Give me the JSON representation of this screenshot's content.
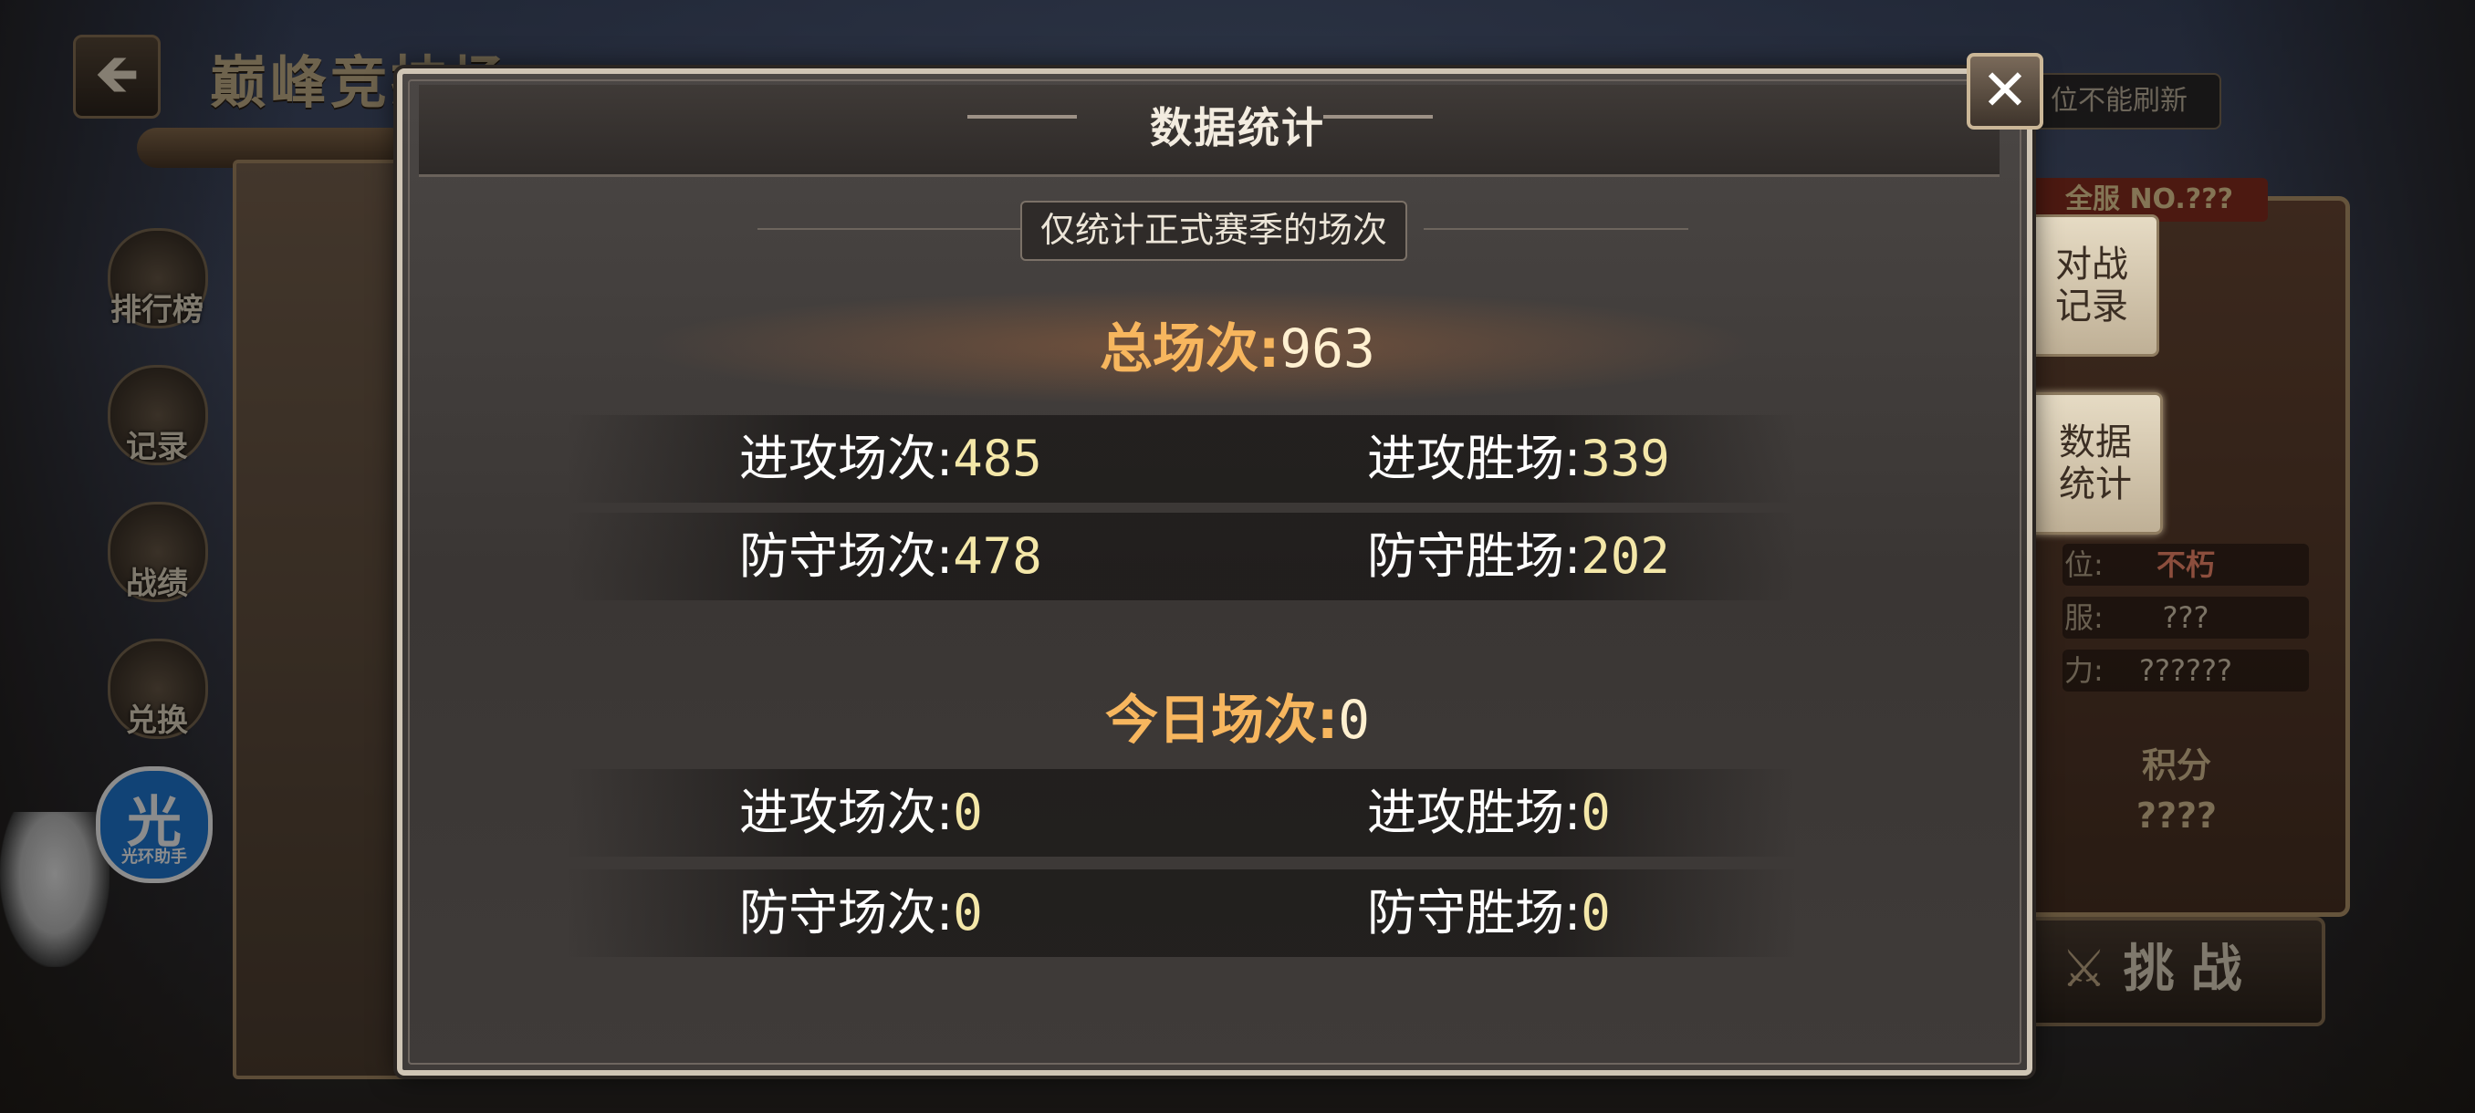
{
  "header": {
    "back_icon": "left-arrow-icon",
    "page_title": "巅峰竞技场"
  },
  "side_menu": {
    "items": [
      {
        "label": "排行榜",
        "icon": "trophy-icon"
      },
      {
        "label": "记录",
        "icon": "book-icon"
      },
      {
        "label": "战绩",
        "icon": "shield-icon"
      },
      {
        "label": "兑换",
        "icon": "scale-icon"
      }
    ]
  },
  "assistant": {
    "glyph": "光",
    "label": "光环助手"
  },
  "right_panel": {
    "notice": "位不能刷新",
    "rank_tag": "全服 NO.???",
    "tabs": [
      {
        "label": "对战\n记录"
      },
      {
        "label": "数据\n统计"
      }
    ],
    "rows": [
      {
        "key": "位:",
        "value": "不朽"
      },
      {
        "key": "服:",
        "value": "???"
      },
      {
        "key": "力:",
        "value": "??????"
      }
    ],
    "score_label": "积分",
    "score_value": "????",
    "challenge_label": "挑战"
  },
  "modal": {
    "title": "数据统计",
    "subtitle": "仅统计正式赛季的场次",
    "close_icon": "close-x-icon",
    "total": {
      "label": "总场次:",
      "value": "963"
    },
    "total_stats": [
      {
        "left": {
          "label": "进攻场次:",
          "value": "485"
        },
        "right": {
          "label": "进攻胜场:",
          "value": "339"
        }
      },
      {
        "left": {
          "label": "防守场次:",
          "value": "478"
        },
        "right": {
          "label": "防守胜场:",
          "value": "202"
        }
      }
    ],
    "today": {
      "label": "今日场次:",
      "value": "0"
    },
    "today_stats": [
      {
        "left": {
          "label": "进攻场次:",
          "value": "0"
        },
        "right": {
          "label": "进攻胜场:",
          "value": "0"
        }
      },
      {
        "left": {
          "label": "防守场次:",
          "value": "0"
        },
        "right": {
          "label": "防守胜场:",
          "value": "0"
        }
      }
    ]
  }
}
